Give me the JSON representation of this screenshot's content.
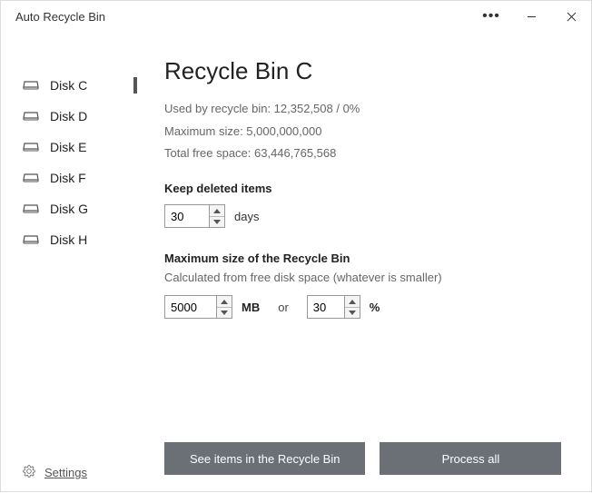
{
  "window": {
    "title": "Auto Recycle Bin"
  },
  "sidebar": {
    "items": [
      {
        "label": "Disk C",
        "selected": true
      },
      {
        "label": "Disk D",
        "selected": false
      },
      {
        "label": "Disk E",
        "selected": false
      },
      {
        "label": "Disk F",
        "selected": false
      },
      {
        "label": "Disk G",
        "selected": false
      },
      {
        "label": "Disk H",
        "selected": false
      }
    ],
    "settings_label": "Settings"
  },
  "main": {
    "title": "Recycle Bin C",
    "used_prefix": "Used by recycle bin: ",
    "used_value": "12,352,508 / 0%",
    "max_prefix": "Maximum size: ",
    "max_value": "5,000,000,000",
    "free_prefix": "Total free space: ",
    "free_value": "63,446,765,568",
    "keep_label": "Keep deleted items",
    "keep_days_value": "30",
    "keep_days_unit": "days",
    "maxsize_label": "Maximum size of the Recycle Bin",
    "maxsize_sub": "Calculated from free disk space (whatever is smaller)",
    "maxsize_mb_value": "5000",
    "maxsize_mb_unit": "MB",
    "or": "or",
    "maxsize_pct_value": "30",
    "maxsize_pct_unit": "%",
    "see_items_btn": "See items in the Recycle Bin",
    "process_btn": "Process all"
  }
}
